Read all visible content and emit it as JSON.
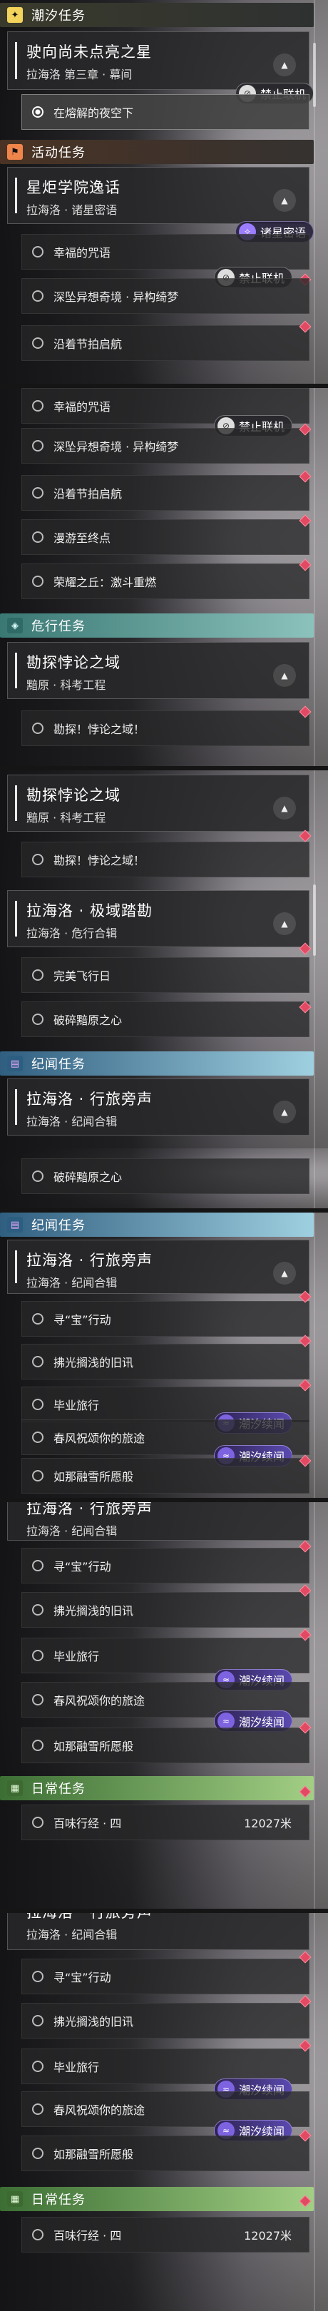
{
  "labels": {
    "chaoxi": "潮汐任务",
    "huodong": "活动任务",
    "weixing": "危行任务",
    "jiwen": "纪闻任务",
    "richang": "日常任务",
    "jinzhi": "禁止联机",
    "zhuxing": "诸星密语",
    "chaoxi_xuwen": "潮汐续闻"
  },
  "quests": {
    "q1_title": "驶向尚未点亮之星",
    "q1_sub": "拉海洛 第三章 · 幕间",
    "q1_row": "在熔解的夜空下",
    "q2_title": "星炬学院逸话",
    "q2_sub": "拉海洛 · 诸星密语",
    "r_xingfu": "幸福的咒语",
    "r_shenjian": "深坠异想奇境 · 异构绮梦",
    "r_yanzhe": "沿着节拍启航",
    "r_manyou": "漫游至终点",
    "r_rongyao": "荣耀之丘：激斗重燃",
    "q3_title": "勘探悖论之域",
    "q3_sub": "黯原 · 科考工程",
    "r_kantan": "勘探！悖论之域！",
    "q4_title": "拉海洛 · 极域踏勘",
    "q4_sub": "拉海洛 · 危行合辑",
    "r_wanmei": "完美飞行日",
    "r_posui": "破碎黯原之心",
    "q5_title": "拉海洛 · 行旅旁声",
    "q5_sub": "拉海洛 · 纪闻合辑",
    "r_xunbao": "寻“宝”行动",
    "r_fuguang": "拂光搁浅的旧讯",
    "r_biye": "毕业旅行",
    "r_chunfeng": "春风祝颂你的旅途",
    "r_rurong": "如那融雪所愿般",
    "r_baiwei": "百味行经 · 四",
    "r_dist": "12027米"
  },
  "colors": {
    "accent_red": "#e24a64",
    "yellow": "#f2d35c",
    "orange": "#f0854b",
    "teal": "#8cc2bc",
    "cyan": "#9fd0e0",
    "green": "#a2cf84"
  },
  "icons": {
    "chaoxi": "sparkle-icon",
    "huodong": "flag-icon",
    "weixing": "shield-icon",
    "jiwen": "book-icon",
    "richang": "calendar-icon"
  }
}
